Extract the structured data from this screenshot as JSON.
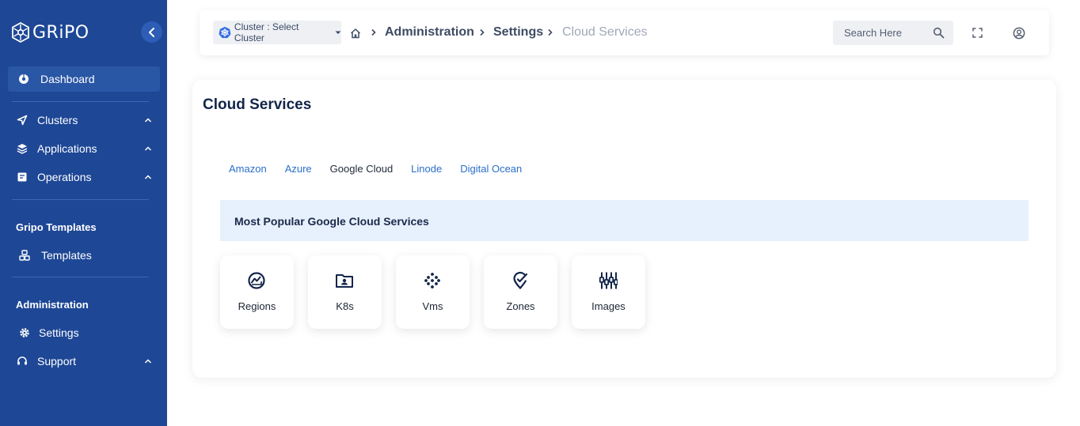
{
  "sidebar": {
    "logo_text": "GRiPO",
    "items": [
      {
        "label": "Dashboard",
        "icon": "dashboard-icon"
      },
      {
        "label": "Clusters",
        "icon": "send-icon"
      },
      {
        "label": "Applications",
        "icon": "layers-icon"
      },
      {
        "label": "Operations",
        "icon": "operations-icon"
      },
      {
        "label": "Templates",
        "icon": "templates-icon"
      },
      {
        "label": "Settings",
        "icon": "gear-icon"
      },
      {
        "label": "Support",
        "icon": "headset-icon"
      }
    ],
    "sections": {
      "templates_title": "Gripo Templates",
      "administration_title": "Administration"
    }
  },
  "topbar": {
    "cluster_select": "Cluster : Select Cluster",
    "breadcrumb": [
      "Administration",
      "Settings",
      "Cloud Services"
    ],
    "search_placeholder": "Search Here"
  },
  "main": {
    "title": "Cloud Services",
    "tabs": [
      {
        "label": "Amazon",
        "active": false
      },
      {
        "label": "Azure",
        "active": false
      },
      {
        "label": "Google Cloud",
        "active": true
      },
      {
        "label": "Linode",
        "active": false
      },
      {
        "label": "Digital Ocean",
        "active": false
      }
    ],
    "banner": "Most Popular Google Cloud Services",
    "services": [
      {
        "label": "Regions",
        "icon": "regions-icon"
      },
      {
        "label": "K8s",
        "icon": "k8s-folder-icon"
      },
      {
        "label": "Vms",
        "icon": "vms-icon"
      },
      {
        "label": "Zones",
        "icon": "zones-icon"
      },
      {
        "label": "Images",
        "icon": "images-icon"
      }
    ]
  },
  "colors": {
    "sidebar_bg": "#1e4796",
    "accent_link": "#2a6fc9",
    "banner_bg": "#e7f0fd",
    "title_text": "#12254a"
  }
}
